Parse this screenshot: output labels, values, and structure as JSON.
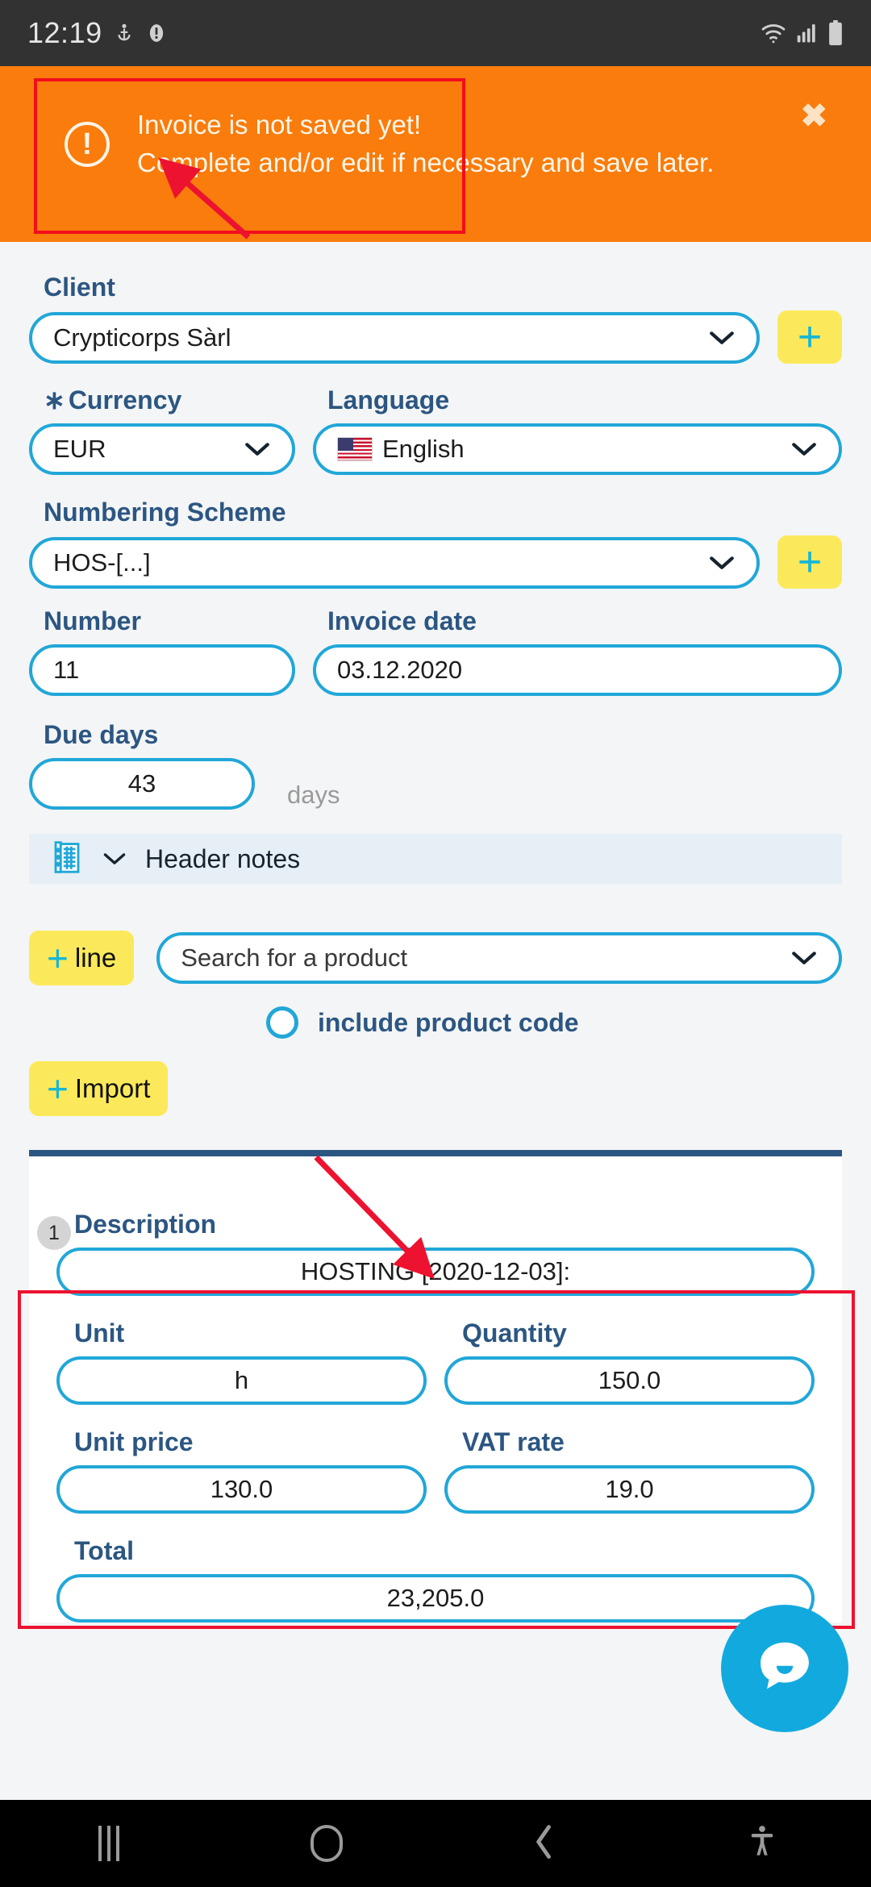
{
  "statusbar": {
    "time": "12:19",
    "icons_left": [
      "anchor-icon",
      "alert-circle-icon"
    ],
    "icons_right": [
      "wifi-icon",
      "signal-icon",
      "battery-icon"
    ]
  },
  "alert": {
    "title": "Invoice is not saved yet!",
    "message": "Complete and/or edit if necessary and save later.",
    "icon": "exclamation-circle-icon",
    "close_label": "✖",
    "background_color": "#f97c0c"
  },
  "form": {
    "client": {
      "label": "Client",
      "value": "Crypticorps Sàrl",
      "add_label": "+"
    },
    "currency": {
      "label": "Currency",
      "required": true,
      "value": "EUR"
    },
    "language": {
      "label": "Language",
      "value": "English",
      "flag": "us-flag-icon"
    },
    "numbering_scheme": {
      "label": "Numbering Scheme",
      "value": "HOS-[...]",
      "add_label": "+"
    },
    "number": {
      "label": "Number",
      "value": "11"
    },
    "invoice_date": {
      "label": "Invoice date",
      "value": "03.12.2020"
    },
    "due_days": {
      "label": "Due days",
      "value": "43",
      "suffix": "days"
    },
    "header_notes": {
      "label": "Header notes",
      "icon": "notes-book-icon",
      "chevron": "chevron-down-icon"
    }
  },
  "products": {
    "add_line_label": "line",
    "add_line_plus": "+",
    "search_placeholder": "Search for a product",
    "include_product_code_label": "include product code",
    "include_product_code_checked": false,
    "import_label": "Import",
    "import_plus": "+"
  },
  "line_item": {
    "seq": "1",
    "description_label": "Description",
    "description_value": "HOSTING [2020-12-03]:",
    "unit_label": "Unit",
    "unit_value": "h",
    "quantity_label": "Quantity",
    "quantity_value": "150.0",
    "unit_price_label": "Unit price",
    "unit_price_value": "130.0",
    "vat_rate_label": "VAT rate",
    "vat_rate_value": "19.0",
    "total_label": "Total",
    "total_value": "23,205.0"
  },
  "chat": {
    "icon": "chat-bubble-icon",
    "color": "#12aade"
  },
  "navbar": {
    "recents": "recents-icon",
    "home": "home-icon",
    "back": "back-icon",
    "accessibility": "accessibility-icon"
  },
  "annotations": {
    "highlight_color": "#ed1230"
  }
}
